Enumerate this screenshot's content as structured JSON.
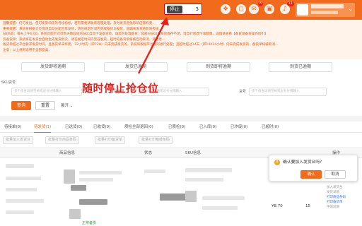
{
  "header": {
    "stop_button": "停止",
    "stop_count": "3",
    "badges": {
      "msg": "8",
      "bell": "11"
    },
    "user_name": "",
    "user_sub": "个人主页"
  },
  "notice": {
    "lines": [
      "温馨提醒：仍可发出，但可能影响您的考核指标，若有需要请联系客服处理，及时发货避免影响店铺权重…",
      "重要提醒：系统将根据仓位情况自动分配合单发货，请在规定时间内完成备货与发货，逾期未发货将影响考核…",
      "AB商品：每天上午6:00，系统可能针对可售天数较短的SKC自动下发备货单，请及时处理备货；如部分SKU可发货库存不足，可自行修改下单数量。详情请查看【备货单备货操作指引】",
      "仅备货单：系统将在发货台自动生成发货批次，请在规定时间内完成发货，超时的备货单将被自动取消，请注意…",
      "备货单超过平台要求发货时间，且备货单未作废，72小时内（即72H）内未完成发货的，系统将根据平台规则进行处理；且超时超过14天（即14X24小时）内未完成发货的，备货单将被取消…",
      "注意：以上规则适用于全部品类。"
    ]
  },
  "stages": [
    "发货即将逾期",
    "发货已逾期",
    "到货即将逾期",
    "到货已逾期"
  ],
  "filters": {
    "sku_label": "SKU货号",
    "sku_placeholder": "多个值查询请空格或逗号分隔输入",
    "order_label": "备货单号",
    "order_placeholder": "多个值查询请空格或逗号分隔输入",
    "goods_label": "货号",
    "goods_placeholder": "多个值查询请空格或逗号分隔输入"
  },
  "buttons": {
    "query": "查询",
    "reset": "重置",
    "expand": "展开"
  },
  "annotation": "随时停止抢仓位",
  "tabs": [
    "待接单",
    "待发货",
    "已送货",
    "已收货",
    "质检全部退回",
    "已质检",
    "已入库",
    "已作废",
    "已超时"
  ],
  "tab_counts": [
    "(0)",
    "(1)",
    "(0)",
    "(0)",
    "(0)",
    "(0)",
    "(0)",
    "(0)",
    "(0)"
  ],
  "batch_buttons": [
    "批量加入发货台",
    "批量打印商品条码",
    "批量打印备货单",
    "批量打印箱唛条码"
  ],
  "table_headers": [
    "商品信息",
    "状态",
    "SKU信息",
    "操作"
  ],
  "row": {
    "price": "¥8.70",
    "qty": "15",
    "status": "正常备货",
    "side_links": [
      {
        "text": "加入发货台",
        "style": "grey"
      },
      {
        "text": "发货详情",
        "style": "grey"
      },
      {
        "text": "打印商品条码",
        "style": "blue"
      },
      {
        "text": "打印备货单",
        "style": "blue"
      },
      {
        "text": "申请延期",
        "style": "grey"
      }
    ]
  },
  "popover": {
    "question": "确认要加入发货台吗?",
    "ok": "确认",
    "cancel": "取消"
  },
  "colors": {
    "accent": "#f26b1d",
    "annotation": "#e8201c"
  }
}
